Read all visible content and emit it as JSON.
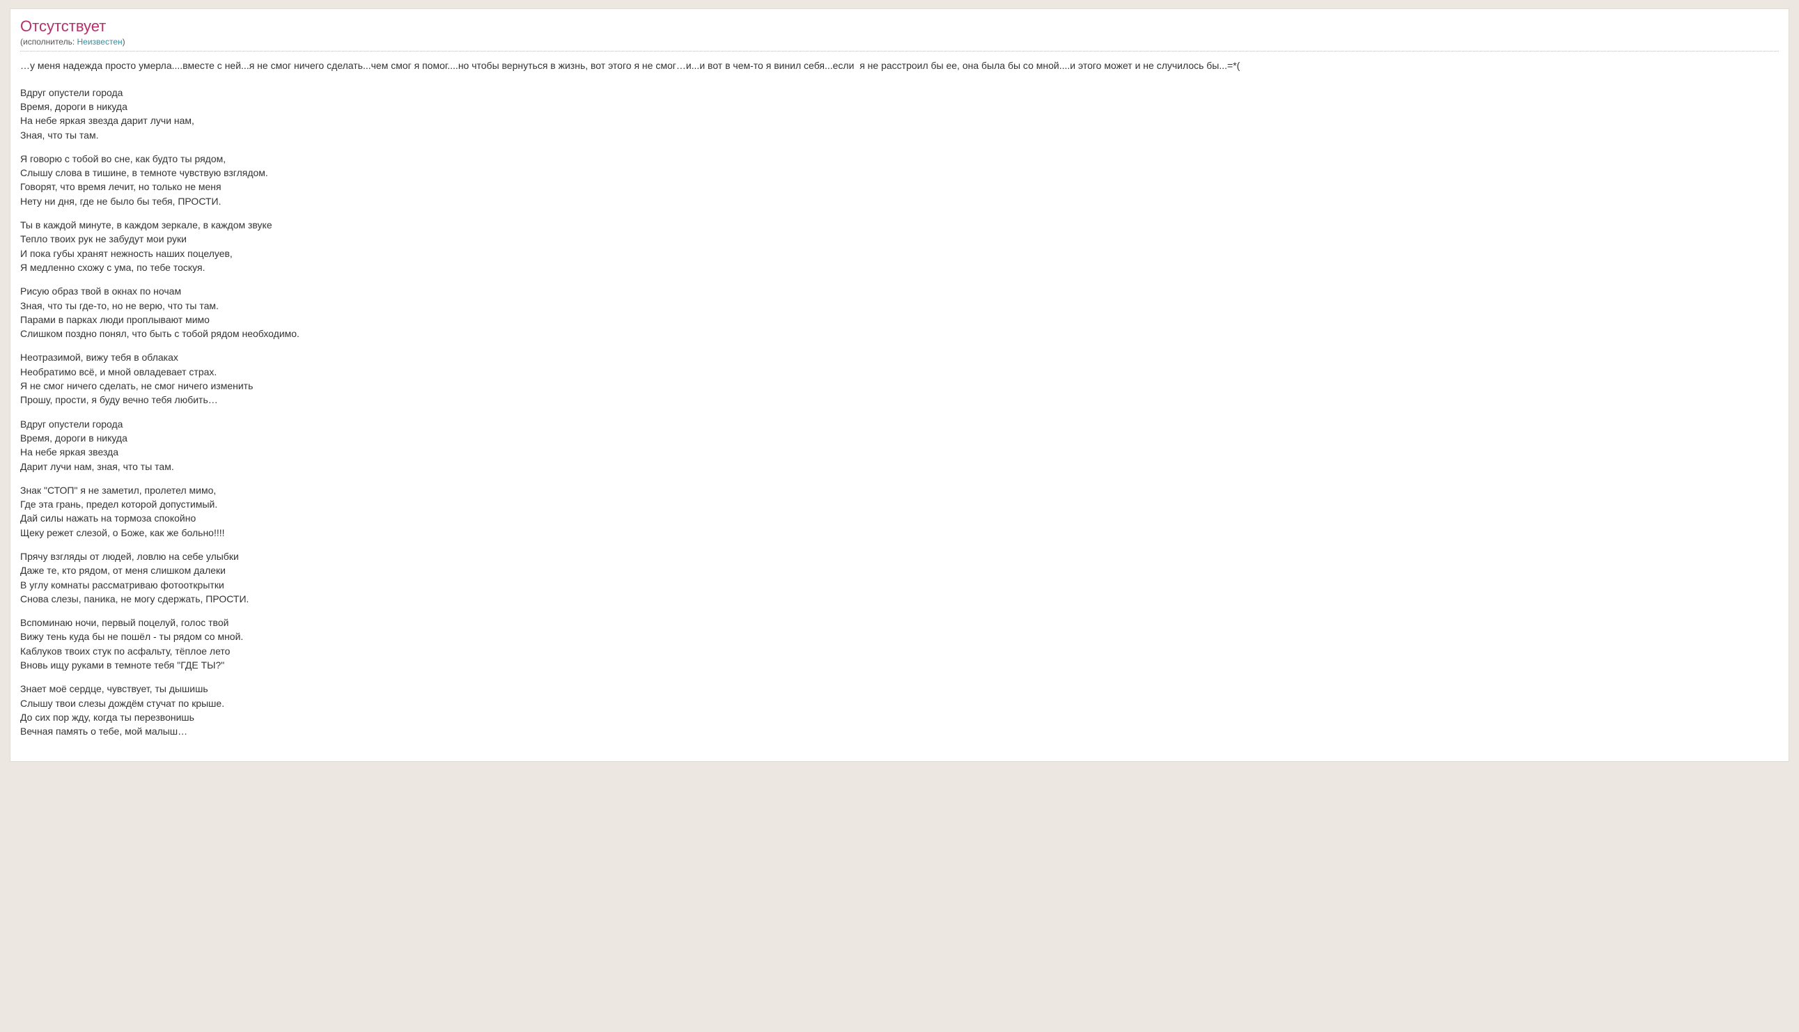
{
  "header": {
    "title": "Отсутствует",
    "performer_prefix": "(исполнитель: ",
    "performer_link": "Неизвестен",
    "performer_suffix": ")"
  },
  "intro": "…у меня надежда просто умерла....вместе с ней...я не смог ничего сделать...чем смог я помог....но чтобы вернуться в жизнь, вот этого я не смог…и...и вот в чем-то я винил себя...если  я не расстроил бы ее, она была бы со мной....и этого может и не случилось бы...=*(",
  "stanzas": [
    "Вдруг опустели города\nВремя, дороги в никуда\nНа небе яркая звезда дарит лучи нам,\nЗная, что ты там.",
    "Я говорю с тобой во сне, как будто ты рядом,\nСлышу слова в тишине, в темноте чувствую взглядом.\nГоворят, что время лечит, но только не меня\nНету ни дня, где не было бы тебя, ПРОСТИ.",
    "Ты в каждой минуте, в каждом зеркале, в каждом звуке\nТепло твоих рук не забудут мои руки\nИ пока губы хранят нежность наших поцелуев,\nЯ медленно схожу с ума, по тебе тоскуя.",
    "Рисую образ твой в окнах по ночам\nЗная, что ты где-то, но не верю, что ты там.\nПарами в парках люди проплывают мимо\nСлишком поздно понял, что быть с тобой рядом необходимо.",
    "Неотразимой, вижу тебя в облаках\nНеобратимо всё, и мной овладевает страх.\nЯ не смог ничего сделать, не смог ничего изменить\nПрошу, прости, я буду вечно тебя любить…",
    "Вдруг опустели города\nВремя, дороги в никуда\nНа небе яркая звезда\nДарит лучи нам, зная, что ты там.",
    "Знак \"СТОП\" я не заметил, пролетел мимо,\nГде эта грань, предел которой допустимый.\nДай силы нажать на тормоза спокойно\nЩеку режет слезой, о Боже, как же больно!!!!",
    "Прячу взгляды от людей, ловлю на себе улыбки\nДаже те, кто рядом, от меня слишком далеки\nВ углу комнаты рассматриваю фотооткрытки\nСнова слезы, паника, не могу сдержать, ПРОСТИ.",
    "Вспоминаю ночи, первый поцелуй, голос твой\nВижу тень куда бы не пошёл - ты рядом со мной.\nКаблуков твоих стук по асфальту, тёплое лето\nВновь ищу руками в темноте тебя \"ГДЕ ТЫ?\"",
    "Знает моё сердце, чувствует, ты дышишь\nСлышу твои слезы дождём стучат по крыше.\nДо сих пор жду, когда ты перезвонишь\nВечная память о тебе, мой малыш…"
  ]
}
